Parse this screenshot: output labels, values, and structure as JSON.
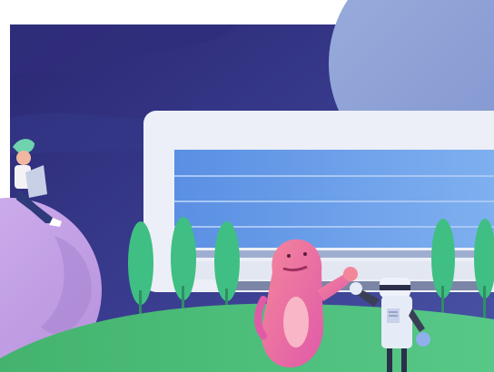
{
  "illustration": {
    "subject": "spot-illustration",
    "colors": {
      "sky_dark": "#2a2a72",
      "sky_mid": "#3a3d8f",
      "moon": "#9fb3de",
      "monitor_frame": "#e9edf6",
      "monitor_screen": "#5d93e6",
      "ground": "#4cbf7a",
      "tree": "#3fbf83",
      "planet": "#c7a6e4",
      "monster": "#f07aa0",
      "robot": "#e6ecf7"
    }
  }
}
